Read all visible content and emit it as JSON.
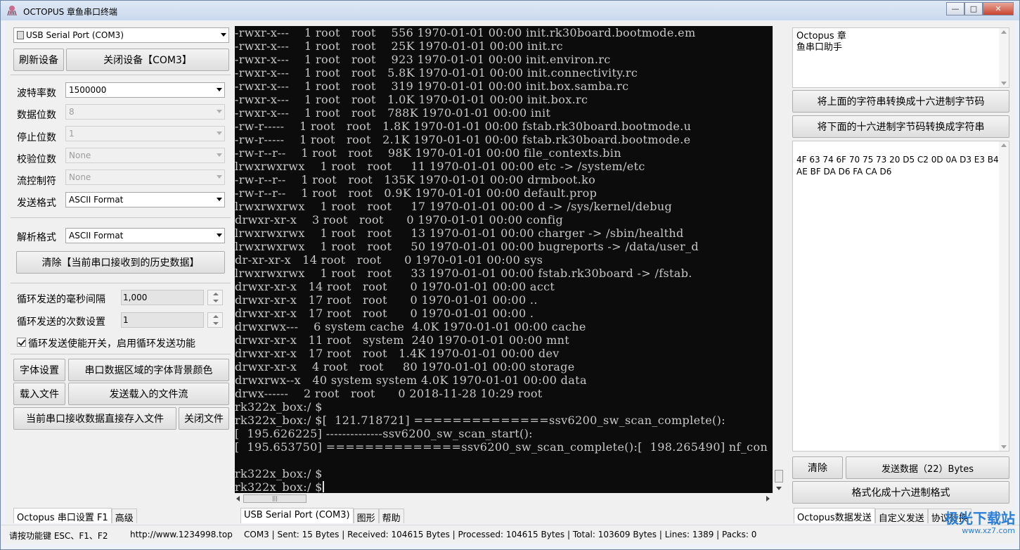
{
  "window": {
    "title": "OCTOPUS 章鱼串口终端",
    "controls": [
      "minimize",
      "maximize",
      "close"
    ]
  },
  "left": {
    "port_select": "USB Serial Port (COM3)",
    "refresh_button": "刷新设备",
    "close_device_button": "关闭设备【COM3】",
    "settings": {
      "baud_label": "波特率数",
      "baud_value": "1500000",
      "databits_label": "数据位数",
      "databits_value": "8",
      "stopbits_label": "停止位数",
      "stopbits_value": "1",
      "parity_label": "校验位数",
      "parity_value": "None",
      "flow_label": "流控制符",
      "flow_value": "None",
      "sendfmt_label": "发送格式",
      "sendfmt_value": "ASCII Format"
    },
    "parse_label": "解析格式",
    "parse_value": "ASCII Format",
    "clear_history_button": "清除【当前串口接收到的历史数据】",
    "loop_interval_label": "循环发送的毫秒间隔",
    "loop_interval_value": "1,000",
    "loop_count_label": "循环发送的次数设置",
    "loop_count_value": "1",
    "loop_enable_label": "循环发送使能开关，启用循环发送功能",
    "font_button": "字体设置",
    "bgcolor_button": "串口数据区域的字体背景颜色",
    "load_file_button": "载入文件",
    "send_file_button": "发送载入的文件流",
    "save_to_file_button": "当前串口接收数据直接存入文件",
    "close_file_button": "关闭文件"
  },
  "terminal": {
    "lines": [
      "-rwxr-x---    1 root   root    556 1970-01-01 00:00 init.rk30board.bootmode.em",
      "-rwxr-x---    1 root   root    25K 1970-01-01 00:00 init.rc",
      "-rwxr-x---    1 root   root    923 1970-01-01 00:00 init.environ.rc",
      "-rwxr-x---    1 root   root   5.8K 1970-01-01 00:00 init.connectivity.rc",
      "-rwxr-x---    1 root   root    319 1970-01-01 00:00 init.box.samba.rc",
      "-rwxr-x---    1 root   root   1.0K 1970-01-01 00:00 init.box.rc",
      "-rwxr-x---    1 root   root   788K 1970-01-01 00:00 init",
      "-rw-r-----    1 root   root   1.8K 1970-01-01 00:00 fstab.rk30board.bootmode.u",
      "-rw-r-----    1 root   root   2.1K 1970-01-01 00:00 fstab.rk30board.bootmode.e",
      "-rw-r--r--    1 root   root    98K 1970-01-01 00:00 file_contexts.bin",
      "lrwxrwxrwx    1 root   root     11 1970-01-01 00:00 etc -> /system/etc",
      "-rw-r--r--    1 root   root   135K 1970-01-01 00:00 drmboot.ko",
      "-rw-r--r--    1 root   root   0.9K 1970-01-01 00:00 default.prop",
      "lrwxrwxrwx    1 root   root     17 1970-01-01 00:00 d -> /sys/kernel/debug",
      "drwxr-xr-x    3 root   root      0 1970-01-01 00:00 config",
      "lrwxrwxrwx    1 root   root     13 1970-01-01 00:00 charger -> /sbin/healthd",
      "lrwxrwxrwx    1 root   root     50 1970-01-01 00:00 bugreports -> /data/user_d",
      "dr-xr-xr-x   14 root   root      0 1970-01-01 00:00 sys",
      "lrwxrwxrwx    1 root   root     33 1970-01-01 00:00 fstab.rk30board -> /fstab.",
      "drwxr-xr-x   14 root   root      0 1970-01-01 00:00 acct",
      "drwxr-xr-x   17 root   root      0 1970-01-01 00:00 ..",
      "drwxr-xr-x   17 root   root      0 1970-01-01 00:00 .",
      "drwxrwx---    6 system cache  4.0K 1970-01-01 00:00 cache",
      "drwxr-xr-x   11 root   system  240 1970-01-01 00:00 mnt",
      "drwxr-xr-x   17 root   root   1.4K 1970-01-01 00:00 dev",
      "drwxr-xr-x    4 root   root     80 1970-01-01 00:00 storage",
      "drwxrwx--x   40 system system 4.0K 1970-01-01 00:00 data",
      "drwx------    2 root   root      0 2018-11-28 10:29 root",
      "rk322x_box:/ $",
      "rk322x_box:/ $[  121.718721] ==============ssv6200_sw_scan_complete():",
      "[  195.626225] --------------ssv6200_sw_scan_start():",
      "[  195.653750] ==============ssv6200_sw_scan_complete():[  198.265490] nf_con",
      "",
      "rk322x_box:/ $",
      "rk322x_box:/ $"
    ]
  },
  "right": {
    "input_text": "Octopus 章\n鱼串口助手",
    "to_hex_button": "将上面的字符串转换成十六进制字节码",
    "to_string_button": "将下面的十六进制字节码转换成字符串",
    "hex_text": "4F 63 74 6F 70 75 73 20 D5 C2 0D 0A D3 E3 B4\nAE BF DA D6 FA CA D6",
    "clear_button": "清除",
    "send_button": "发送数据（22）Bytes",
    "format_button": "格式化成十六进制格式"
  },
  "tabs": {
    "left": [
      "Octopus 串口设置 F1",
      "高级"
    ],
    "middle": [
      "USB Serial Port (COM3)",
      "图形",
      "帮助"
    ],
    "right": [
      "Octopus数据发送",
      "自定义发送",
      "协议转换"
    ]
  },
  "status": {
    "hint": "请按功能键 ESC、F1、F2",
    "url": "http://www.1234998.top",
    "stats": "COM3 | Sent: 15 Bytes | Received: 104615 Bytes | Processed: 104615 Bytes | Total: 103609 Bytes | Lines: 1389 | Packs: 0"
  },
  "watermark": {
    "brand": "极光下载站",
    "site": "www.xz7.com"
  }
}
